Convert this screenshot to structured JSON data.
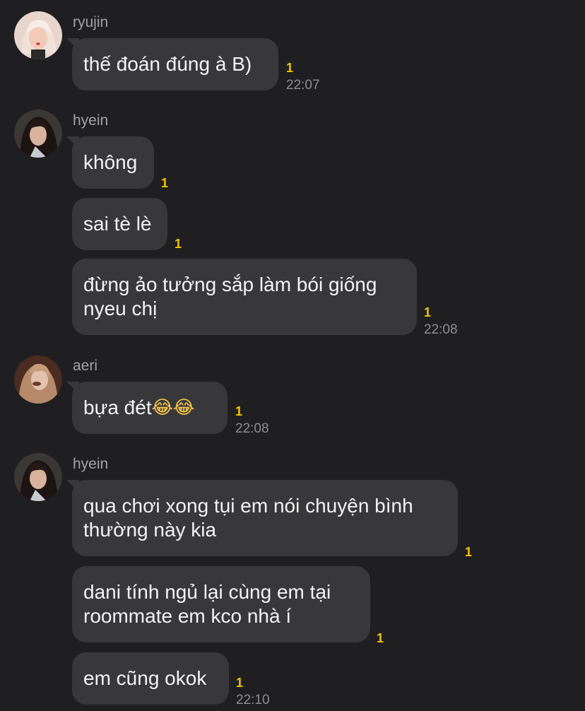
{
  "messages": {
    "g1": {
      "sender": "ryujin",
      "m1": {
        "text": "thế đoán đúng à B)",
        "unread": "1",
        "time": "22:07"
      }
    },
    "g2": {
      "sender": "hyein",
      "m1": {
        "text": "không",
        "unread": "1"
      },
      "m2": {
        "text": "sai tè lè",
        "unread": "1"
      },
      "m3": {
        "text": "đừng ảo tưởng sắp làm bói giống nyeu chị",
        "line1": "đừng ảo tưởng sắp làm bói giống",
        "line2": "nyeu chị",
        "unread": "1",
        "time": "22:08"
      }
    },
    "g3": {
      "sender": "aeri",
      "m1": {
        "text": "bựa đét",
        "emoji": "😂😂",
        "unread": "1",
        "time": "22:08"
      }
    },
    "g4": {
      "sender": "hyein",
      "m1": {
        "line1": "qua chơi xong tụi em nói chuyện bình",
        "line2": "thường này kia",
        "unread": "1"
      },
      "m2": {
        "line1": "dani tính ngủ lại cùng em tại",
        "line2": "roommate em kco nhà í",
        "unread": "1"
      },
      "m3": {
        "text": "em cũng okok",
        "unread": "1",
        "time": "22:10"
      }
    }
  },
  "colors": {
    "background": "#1f1f21",
    "bubble": "#38383b",
    "unread": "#f5c400",
    "meta": "#8d8d92"
  }
}
